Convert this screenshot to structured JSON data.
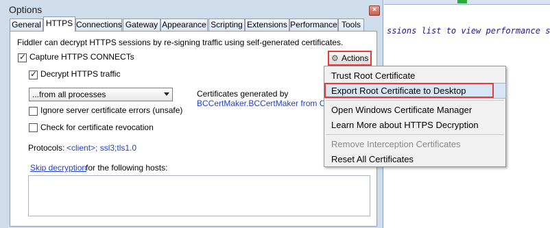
{
  "background_app": {
    "code_text": "ssions list to view performance stat"
  },
  "dialog": {
    "title": "Options",
    "close_glyph": "×",
    "tabs": [
      "General",
      "HTTPS",
      "Connections",
      "Gateway",
      "Appearance",
      "Scripting",
      "Extensions",
      "Performance",
      "Tools"
    ],
    "active_tab": "HTTPS"
  },
  "https": {
    "description": "Fiddler can decrypt HTTPS sessions by re-signing traffic using self-generated certificates.",
    "capture_label": "Capture HTTPS CONNECTs",
    "capture_checked": true,
    "decrypt_label": "Decrypt HTTPS traffic",
    "decrypt_checked": true,
    "process_filter": "...from all processes",
    "ignore_errors_label": "Ignore server certificate errors (unsafe)",
    "ignore_errors_checked": false,
    "revocation_label": "Check for certificate revocation",
    "revocation_checked": false,
    "certs_generated_label": "Certificates generated by",
    "cert_maker": "BCCertMaker.BCCertMaker from Cert",
    "protocols_label": "Protocols:",
    "protocols_value": "<client>; ssl3;tls1.0",
    "skip_link": "Skip decryption",
    "skip_text": "for the following hosts:",
    "hosts_value": "",
    "actions_label": "Actions",
    "gear_icon": "gear-icon"
  },
  "actions_menu": {
    "items": [
      {
        "label": "Trust Root Certificate",
        "enabled": true
      },
      {
        "label": "Export Root Certificate to Desktop",
        "enabled": true,
        "highlighted": true
      },
      {
        "label": "Open Windows Certificate Manager",
        "enabled": true
      },
      {
        "label": "Learn More about HTTPS Decryption",
        "enabled": true
      },
      {
        "label": "Remove Interception Certificates",
        "enabled": false
      },
      {
        "label": "Reset All Certificates",
        "enabled": true
      }
    ]
  },
  "colors": {
    "dialog_bg": "#cfdcec",
    "link": "#1d3fcf",
    "annotation_red": "#e53a3a",
    "menu_highlight": "#d7e6f7"
  }
}
